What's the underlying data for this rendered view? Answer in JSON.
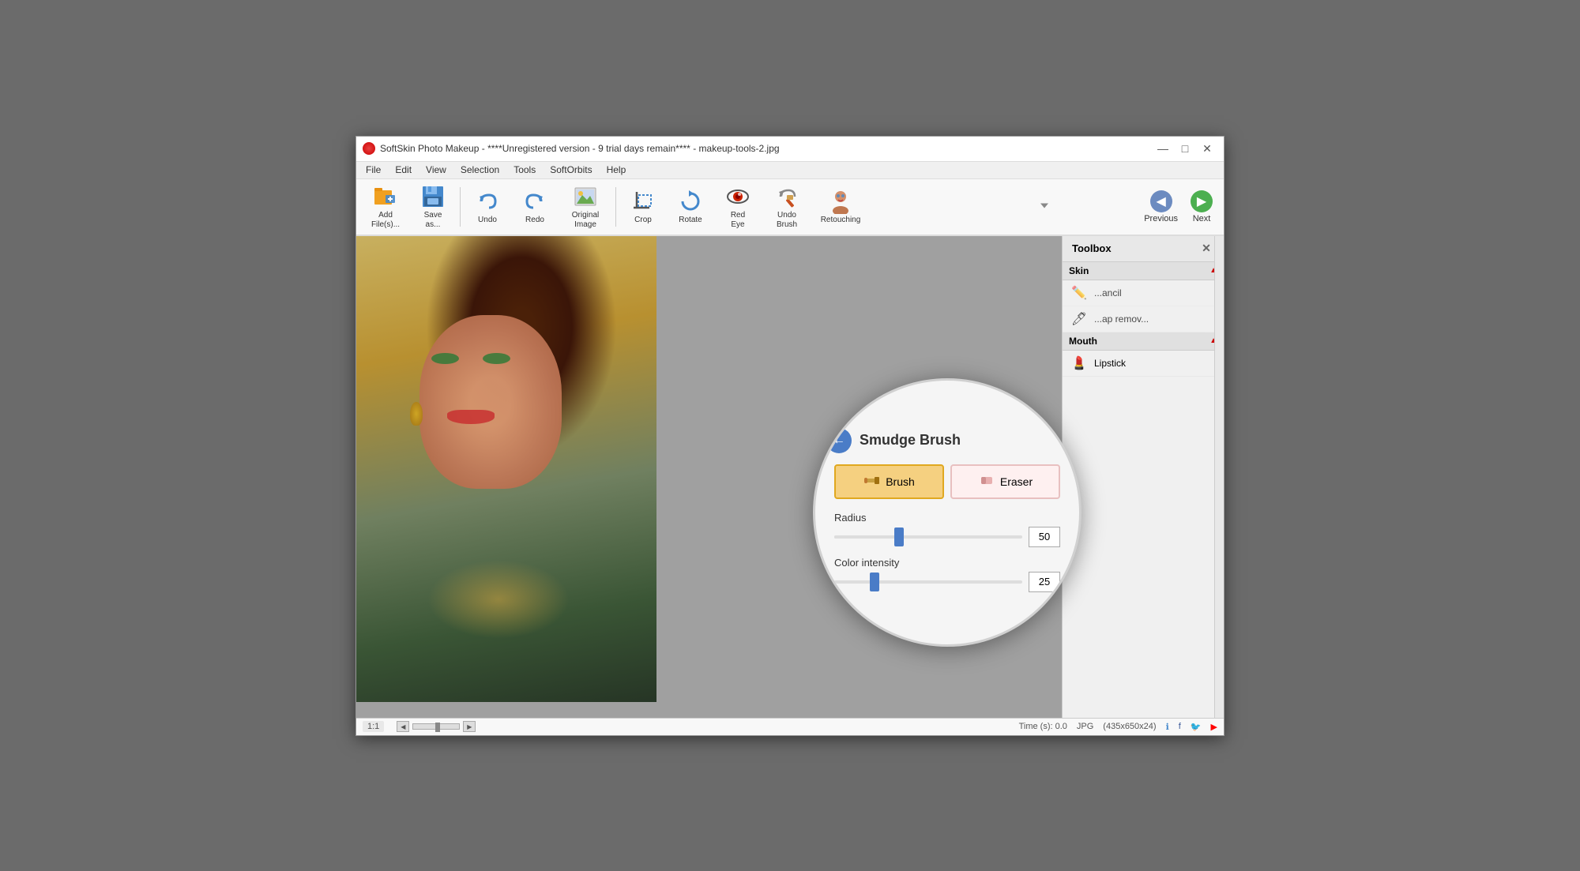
{
  "window": {
    "title": "SoftSkin Photo Makeup - ****Unregistered version - 9 trial days remain**** - makeup-tools-2.jpg",
    "app_name": "SoftSkin Photo Makeup",
    "trial_info": "****Unregistered version - 9 trial days remain****",
    "filename": "makeup-tools-2.jpg"
  },
  "title_controls": {
    "minimize": "—",
    "maximize": "□",
    "close": "✕"
  },
  "menu": {
    "items": [
      "File",
      "Edit",
      "View",
      "Selection",
      "Tools",
      "SoftOrbits",
      "Help"
    ]
  },
  "toolbar": {
    "buttons": [
      {
        "id": "add-files",
        "label": "Add\nFile(s)...",
        "icon": "📂"
      },
      {
        "id": "save-as",
        "label": "Save\nas...",
        "icon": "💾"
      },
      {
        "id": "undo",
        "label": "Undo",
        "icon": "↩"
      },
      {
        "id": "redo",
        "label": "Redo",
        "icon": "↪"
      },
      {
        "id": "original-image",
        "label": "Original\nImage",
        "icon": "🖼"
      },
      {
        "id": "crop",
        "label": "Crop",
        "icon": "✂"
      },
      {
        "id": "rotate",
        "label": "Rotate",
        "icon": "🔄"
      },
      {
        "id": "red-eye",
        "label": "Red\nEye",
        "icon": "👁"
      },
      {
        "id": "undo-brush",
        "label": "Undo\nBrush",
        "icon": "🖌"
      },
      {
        "id": "retouching",
        "label": "Retouching",
        "icon": "👤"
      }
    ],
    "previous": "Previous",
    "next": "Next"
  },
  "toolbox": {
    "title": "Toolbox",
    "close_btn": "✕",
    "sections": [
      {
        "id": "skin",
        "label": "Skin",
        "expanded": true,
        "items": []
      },
      {
        "id": "mouth",
        "label": "Mouth",
        "expanded": true,
        "items": [
          {
            "id": "lipstick",
            "label": "Lipstick",
            "icon": "💄"
          }
        ]
      }
    ],
    "partial_items": [
      {
        "id": "pencil",
        "label": "...ancil",
        "icon": "✏"
      },
      {
        "id": "cap-remov",
        "label": "...ap remov...",
        "icon": "🖊"
      }
    ]
  },
  "smudge_brush": {
    "title": "Smudge Brush",
    "back_label": "←",
    "modes": [
      {
        "id": "brush",
        "label": "Brush",
        "icon": "🖌",
        "active": true
      },
      {
        "id": "eraser",
        "label": "Eraser",
        "icon": "🧹",
        "active": false
      }
    ],
    "radius": {
      "label": "Radius",
      "value": "50",
      "thumb_pct": 35
    },
    "color_intensity": {
      "label": "Color intensity",
      "value": "25",
      "thumb_pct": 22
    }
  },
  "status_bar": {
    "zoom": "1:1",
    "time": "Time (s): 0.0",
    "format": "JPG",
    "dimensions": "(435x650x24)"
  }
}
